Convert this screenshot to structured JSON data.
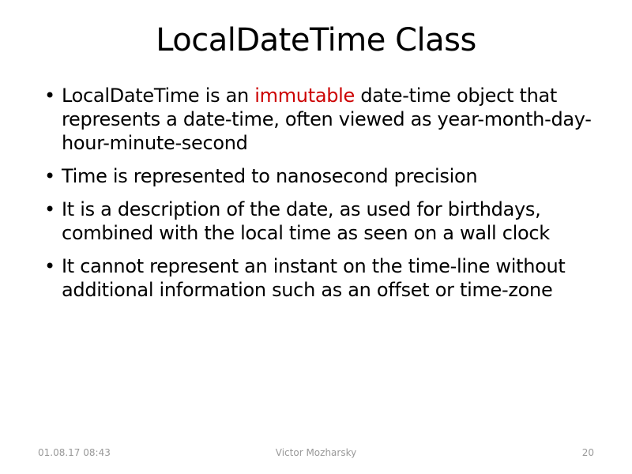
{
  "title": "LocalDateTime Class",
  "bullets": [
    {
      "segments": [
        {
          "text": "LocalDateTime is an ",
          "highlight": false
        },
        {
          "text": "immutable",
          "highlight": true
        },
        {
          "text": " date-time object that represents a date-time, often viewed as year-month-day-hour-minute-second",
          "highlight": false
        }
      ]
    },
    {
      "segments": [
        {
          "text": "Time is represented to nanosecond precision",
          "highlight": false
        }
      ]
    },
    {
      "segments": [
        {
          "text": "It is a description of the date, as used for birthdays, combined with the local time as seen on a wall clock",
          "highlight": false
        }
      ]
    },
    {
      "segments": [
        {
          "text": "It cannot represent an instant on the time-line without additional information such as an offset or time-zone",
          "highlight": false
        }
      ]
    }
  ],
  "footer": {
    "date": "01.08.17 08:43",
    "author": "Victor Mozharsky",
    "page": "20"
  },
  "colors": {
    "highlight": "#cc0000",
    "text": "#000000",
    "footer": "#999999"
  }
}
